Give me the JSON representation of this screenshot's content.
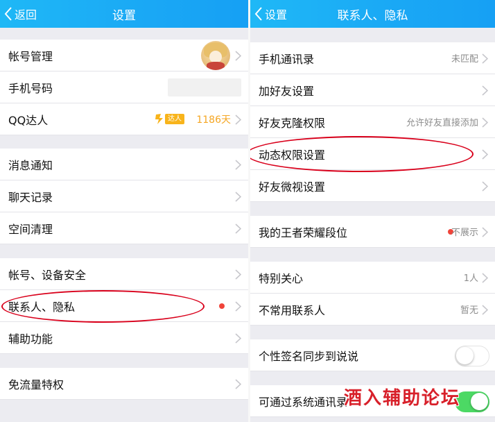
{
  "left": {
    "nav": {
      "back": "返回",
      "title": "设置"
    },
    "rows": {
      "account": "帐号管理",
      "phone": "手机号码",
      "qq_daren": "QQ达人",
      "daren_badge": "达人",
      "daren_days": "1186天",
      "notify": "消息通知",
      "chat": "聊天记录",
      "space": "空间清理",
      "security": "帐号、设备安全",
      "contacts": "联系人、隐私",
      "assist": "辅助功能",
      "traffic": "免流量特权"
    }
  },
  "right": {
    "nav": {
      "back": "设置",
      "title": "联系人、隐私"
    },
    "rows": {
      "phonebook": "手机通讯录",
      "phonebook_value": "未匹配",
      "add_friend": "加好友设置",
      "clone": "好友克隆权限",
      "clone_value": "允许好友直接添加",
      "feed": "动态权限设置",
      "weishi": "好友微视设置",
      "rank": "我的王者荣耀段位",
      "rank_value": "不展示",
      "special": "特别关心",
      "special_value": "1人",
      "rare": "不常用联系人",
      "rare_value": "暂无",
      "signature": "个性签名同步到说说",
      "system_contacts": "可通过系统通讯录"
    }
  },
  "watermark": "酒入辅助论坛",
  "colors": {
    "nav": "#1aa8f5",
    "badge": "#f8b41b",
    "days": "#f5a623",
    "dot": "#f0443a",
    "toggle_on": "#4cd964",
    "highlight": "#d9001b"
  }
}
